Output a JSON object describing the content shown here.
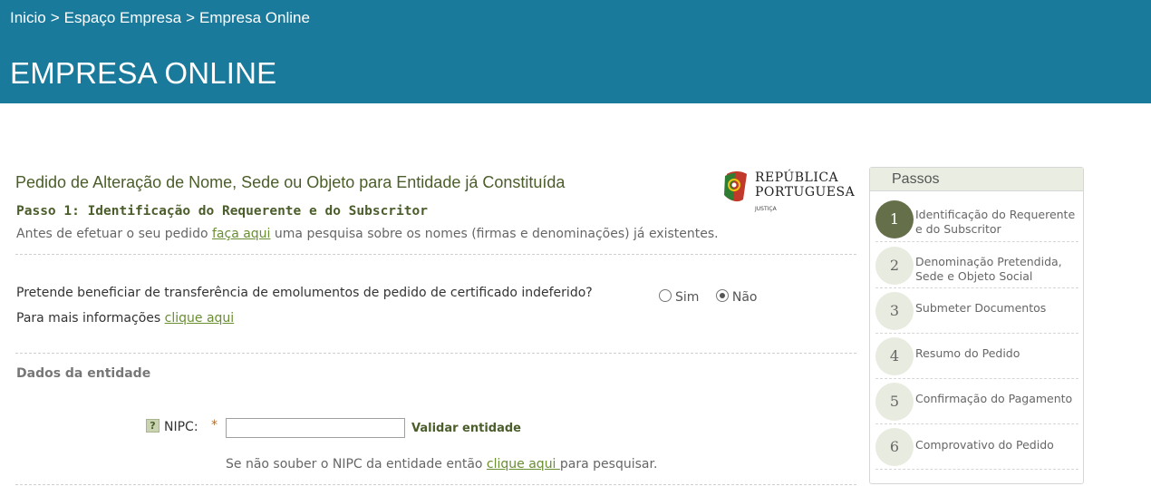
{
  "breadcrumb": {
    "items": [
      "Inicio",
      "Espaço Empresa",
      "Empresa Online"
    ],
    "separator": ">"
  },
  "page_title": "EMPRESA ONLINE",
  "form": {
    "title": "Pedido de Alteração de Nome, Sede ou Objeto para Entidade já Constituída",
    "step_title": "Passo 1: Identificação do Requerente e do Subscritor",
    "intro_before": "Antes de efetuar o seu pedido ",
    "intro_link": "faça aqui",
    "intro_after": " uma pesquisa sobre os nomes (firmas e denominações) já existentes.",
    "question": "Pretende beneficiar de transferência de emolumentos de pedido de certificado indeferido?",
    "more_info_before": "Para mais informações ",
    "more_info_link": "clique aqui",
    "radio": {
      "yes": "Sim",
      "no": "Não",
      "selected": "no"
    },
    "section_title": "Dados da entidade",
    "nipc_label": "NIPC:",
    "required_mark": "*",
    "help_icon_glyph": "?",
    "nipc_value": "",
    "validate_label": "Validar entidade",
    "hint_before": "Se não souber o NIPC da entidade então ",
    "hint_link": "clique aqui ",
    "hint_after": "para pesquisar."
  },
  "logo": {
    "line1": "REPÚBLICA",
    "line2": "PORTUGUESA",
    "subtext": "JUSTIÇA"
  },
  "steps_panel": {
    "title": "Passos",
    "steps": [
      {
        "num": "1",
        "label": "Identificação do Requerente e do Subscritor",
        "active": true
      },
      {
        "num": "2",
        "label": "Denominação Pretendida, Sede e Objeto Social",
        "active": false
      },
      {
        "num": "3",
        "label": "Submeter Documentos",
        "active": false
      },
      {
        "num": "4",
        "label": "Resumo do Pedido",
        "active": false
      },
      {
        "num": "5",
        "label": "Confirmação do Pagamento",
        "active": false
      },
      {
        "num": "6",
        "label": "Comprovativo do Pedido",
        "active": false
      }
    ]
  },
  "colors": {
    "header_bg": "#1a7a9c",
    "title_green": "#4b5d2a",
    "link_green": "#6a8e32",
    "active_step": "#65704a",
    "step_circle": "#e8ebdf"
  }
}
